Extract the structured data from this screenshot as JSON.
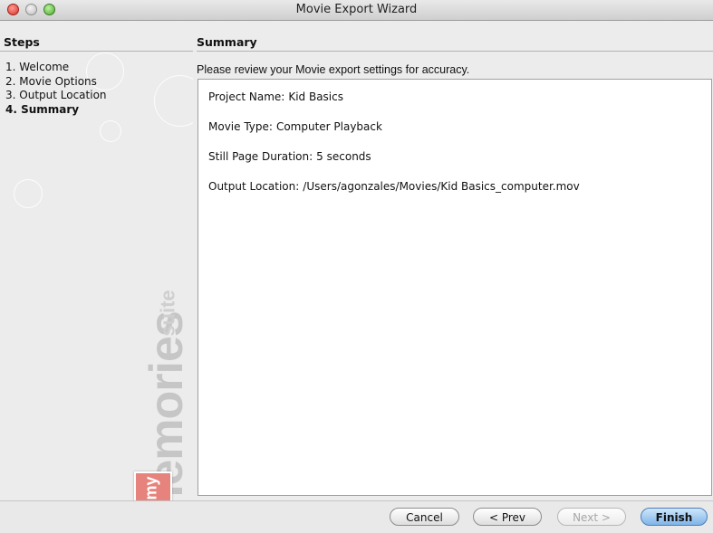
{
  "window": {
    "title": "Movie Export Wizard"
  },
  "steps": {
    "header": "Steps",
    "items": [
      {
        "label": "1. Welcome",
        "active": false
      },
      {
        "label": "2. Movie Options",
        "active": false
      },
      {
        "label": "3. Output Location",
        "active": false
      },
      {
        "label": "4. Summary",
        "active": true
      }
    ]
  },
  "branding": {
    "word1": "memories",
    "word2": "suite",
    "badge": "my"
  },
  "summary": {
    "header": "Summary",
    "instruction": "Please review your Movie export settings for accuracy.",
    "fields": [
      {
        "label": "Project Name:",
        "value": "Kid Basics"
      },
      {
        "label": "Movie Type:",
        "value": "Computer Playback"
      },
      {
        "label": "Still Page Duration:",
        "value": "5 seconds"
      },
      {
        "label": "Output Location:",
        "value": "/Users/agonzales/Movies/Kid Basics_computer.mov"
      }
    ]
  },
  "buttons": {
    "cancel": "Cancel",
    "prev": "< Prev",
    "next": "Next >",
    "finish": "Finish"
  },
  "colors": {
    "finish_accent": "#7fb4e9",
    "close": "#d8332a",
    "zoom": "#4ea72f"
  }
}
